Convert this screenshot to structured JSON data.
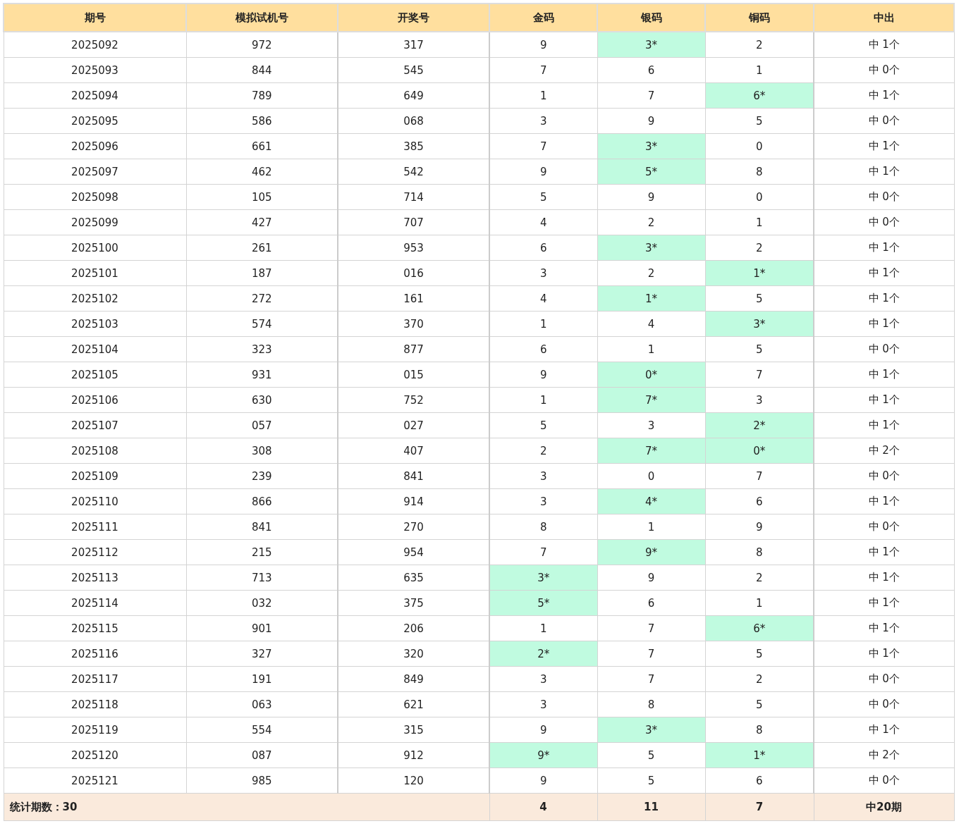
{
  "columns": [
    "期号",
    "模拟试机号",
    "开奖号",
    "金码",
    "银码",
    "铜码",
    "中出"
  ],
  "rows": [
    {
      "period": "2025092",
      "trial": "972",
      "draw": "317",
      "codes": [
        {
          "text": "9",
          "hit": false
        },
        {
          "text": "3*",
          "hit": true
        },
        {
          "text": "2",
          "hit": false
        }
      ],
      "result": "中 1个"
    },
    {
      "period": "2025093",
      "trial": "844",
      "draw": "545",
      "codes": [
        {
          "text": "7",
          "hit": false
        },
        {
          "text": "6",
          "hit": false
        },
        {
          "text": "1",
          "hit": false
        }
      ],
      "result": "中 0个"
    },
    {
      "period": "2025094",
      "trial": "789",
      "draw": "649",
      "codes": [
        {
          "text": "1",
          "hit": false
        },
        {
          "text": "7",
          "hit": false
        },
        {
          "text": "6*",
          "hit": true
        }
      ],
      "result": "中 1个"
    },
    {
      "period": "2025095",
      "trial": "586",
      "draw": "068",
      "codes": [
        {
          "text": "3",
          "hit": false
        },
        {
          "text": "9",
          "hit": false
        },
        {
          "text": "5",
          "hit": false
        }
      ],
      "result": "中 0个"
    },
    {
      "period": "2025096",
      "trial": "661",
      "draw": "385",
      "codes": [
        {
          "text": "7",
          "hit": false
        },
        {
          "text": "3*",
          "hit": true
        },
        {
          "text": "0",
          "hit": false
        }
      ],
      "result": "中 1个"
    },
    {
      "period": "2025097",
      "trial": "462",
      "draw": "542",
      "codes": [
        {
          "text": "9",
          "hit": false
        },
        {
          "text": "5*",
          "hit": true
        },
        {
          "text": "8",
          "hit": false
        }
      ],
      "result": "中 1个"
    },
    {
      "period": "2025098",
      "trial": "105",
      "draw": "714",
      "codes": [
        {
          "text": "5",
          "hit": false
        },
        {
          "text": "9",
          "hit": false
        },
        {
          "text": "0",
          "hit": false
        }
      ],
      "result": "中 0个"
    },
    {
      "period": "2025099",
      "trial": "427",
      "draw": "707",
      "codes": [
        {
          "text": "4",
          "hit": false
        },
        {
          "text": "2",
          "hit": false
        },
        {
          "text": "1",
          "hit": false
        }
      ],
      "result": "中 0个"
    },
    {
      "period": "2025100",
      "trial": "261",
      "draw": "953",
      "codes": [
        {
          "text": "6",
          "hit": false
        },
        {
          "text": "3*",
          "hit": true
        },
        {
          "text": "2",
          "hit": false
        }
      ],
      "result": "中 1个"
    },
    {
      "period": "2025101",
      "trial": "187",
      "draw": "016",
      "codes": [
        {
          "text": "3",
          "hit": false
        },
        {
          "text": "2",
          "hit": false
        },
        {
          "text": "1*",
          "hit": true
        }
      ],
      "result": "中 1个"
    },
    {
      "period": "2025102",
      "trial": "272",
      "draw": "161",
      "codes": [
        {
          "text": "4",
          "hit": false
        },
        {
          "text": "1*",
          "hit": true
        },
        {
          "text": "5",
          "hit": false
        }
      ],
      "result": "中 1个"
    },
    {
      "period": "2025103",
      "trial": "574",
      "draw": "370",
      "codes": [
        {
          "text": "1",
          "hit": false
        },
        {
          "text": "4",
          "hit": false
        },
        {
          "text": "3*",
          "hit": true
        }
      ],
      "result": "中 1个"
    },
    {
      "period": "2025104",
      "trial": "323",
      "draw": "877",
      "codes": [
        {
          "text": "6",
          "hit": false
        },
        {
          "text": "1",
          "hit": false
        },
        {
          "text": "5",
          "hit": false
        }
      ],
      "result": "中 0个"
    },
    {
      "period": "2025105",
      "trial": "931",
      "draw": "015",
      "codes": [
        {
          "text": "9",
          "hit": false
        },
        {
          "text": "0*",
          "hit": true
        },
        {
          "text": "7",
          "hit": false
        }
      ],
      "result": "中 1个"
    },
    {
      "period": "2025106",
      "trial": "630",
      "draw": "752",
      "codes": [
        {
          "text": "1",
          "hit": false
        },
        {
          "text": "7*",
          "hit": true
        },
        {
          "text": "3",
          "hit": false
        }
      ],
      "result": "中 1个"
    },
    {
      "period": "2025107",
      "trial": "057",
      "draw": "027",
      "codes": [
        {
          "text": "5",
          "hit": false
        },
        {
          "text": "3",
          "hit": false
        },
        {
          "text": "2*",
          "hit": true
        }
      ],
      "result": "中 1个"
    },
    {
      "period": "2025108",
      "trial": "308",
      "draw": "407",
      "codes": [
        {
          "text": "2",
          "hit": false
        },
        {
          "text": "7*",
          "hit": true
        },
        {
          "text": "0*",
          "hit": true
        }
      ],
      "result": "中 2个"
    },
    {
      "period": "2025109",
      "trial": "239",
      "draw": "841",
      "codes": [
        {
          "text": "3",
          "hit": false
        },
        {
          "text": "0",
          "hit": false
        },
        {
          "text": "7",
          "hit": false
        }
      ],
      "result": "中 0个"
    },
    {
      "period": "2025110",
      "trial": "866",
      "draw": "914",
      "codes": [
        {
          "text": "3",
          "hit": false
        },
        {
          "text": "4*",
          "hit": true
        },
        {
          "text": "6",
          "hit": false
        }
      ],
      "result": "中 1个"
    },
    {
      "period": "2025111",
      "trial": "841",
      "draw": "270",
      "codes": [
        {
          "text": "8",
          "hit": false
        },
        {
          "text": "1",
          "hit": false
        },
        {
          "text": "9",
          "hit": false
        }
      ],
      "result": "中 0个"
    },
    {
      "period": "2025112",
      "trial": "215",
      "draw": "954",
      "codes": [
        {
          "text": "7",
          "hit": false
        },
        {
          "text": "9*",
          "hit": true
        },
        {
          "text": "8",
          "hit": false
        }
      ],
      "result": "中 1个"
    },
    {
      "period": "2025113",
      "trial": "713",
      "draw": "635",
      "codes": [
        {
          "text": "3*",
          "hit": true
        },
        {
          "text": "9",
          "hit": false
        },
        {
          "text": "2",
          "hit": false
        }
      ],
      "result": "中 1个"
    },
    {
      "period": "2025114",
      "trial": "032",
      "draw": "375",
      "codes": [
        {
          "text": "5*",
          "hit": true
        },
        {
          "text": "6",
          "hit": false
        },
        {
          "text": "1",
          "hit": false
        }
      ],
      "result": "中 1个"
    },
    {
      "period": "2025115",
      "trial": "901",
      "draw": "206",
      "codes": [
        {
          "text": "1",
          "hit": false
        },
        {
          "text": "7",
          "hit": false
        },
        {
          "text": "6*",
          "hit": true
        }
      ],
      "result": "中 1个"
    },
    {
      "period": "2025116",
      "trial": "327",
      "draw": "320",
      "codes": [
        {
          "text": "2*",
          "hit": true
        },
        {
          "text": "7",
          "hit": false
        },
        {
          "text": "5",
          "hit": false
        }
      ],
      "result": "中 1个"
    },
    {
      "period": "2025117",
      "trial": "191",
      "draw": "849",
      "codes": [
        {
          "text": "3",
          "hit": false
        },
        {
          "text": "7",
          "hit": false
        },
        {
          "text": "2",
          "hit": false
        }
      ],
      "result": "中 0个"
    },
    {
      "period": "2025118",
      "trial": "063",
      "draw": "621",
      "codes": [
        {
          "text": "3",
          "hit": false
        },
        {
          "text": "8",
          "hit": false
        },
        {
          "text": "5",
          "hit": false
        }
      ],
      "result": "中 0个"
    },
    {
      "period": "2025119",
      "trial": "554",
      "draw": "315",
      "codes": [
        {
          "text": "9",
          "hit": false
        },
        {
          "text": "3*",
          "hit": true
        },
        {
          "text": "8",
          "hit": false
        }
      ],
      "result": "中 1个"
    },
    {
      "period": "2025120",
      "trial": "087",
      "draw": "912",
      "codes": [
        {
          "text": "9*",
          "hit": true
        },
        {
          "text": "5",
          "hit": false
        },
        {
          "text": "1*",
          "hit": true
        }
      ],
      "result": "中 2个"
    },
    {
      "period": "2025121",
      "trial": "985",
      "draw": "120",
      "codes": [
        {
          "text": "9",
          "hit": false
        },
        {
          "text": "5",
          "hit": false
        },
        {
          "text": "6",
          "hit": false
        }
      ],
      "result": "中 0个"
    }
  ],
  "footer": {
    "label": "统计期数：30",
    "totals": [
      "4",
      "11",
      "7"
    ],
    "summary": "中20期"
  }
}
